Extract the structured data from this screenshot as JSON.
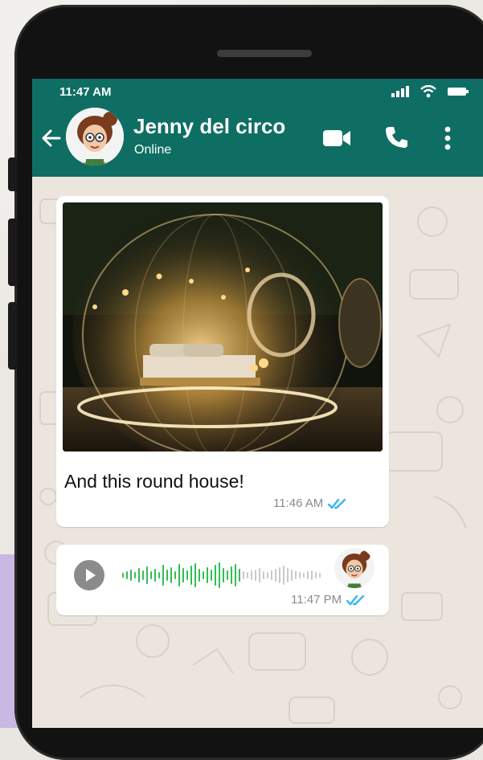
{
  "status_bar": {
    "time": "11:47 AM"
  },
  "contact": {
    "name": "Jenny del circo",
    "status": "Online"
  },
  "header_icons": [
    "back-arrow-icon",
    "video-call-icon",
    "phone-call-icon",
    "more-options-icon"
  ],
  "messages": [
    {
      "type": "image",
      "caption": "And this round house!",
      "time": "11:46 AM",
      "read": true
    },
    {
      "type": "voice",
      "time": "11:47 PM",
      "read": true
    }
  ],
  "colors": {
    "header": "#0f6e63",
    "bubble": "#ffffff",
    "read_ticks": "#34b7f1",
    "waveform_played": "#2fbf52",
    "waveform_unplayed": "#c9c9c9"
  }
}
